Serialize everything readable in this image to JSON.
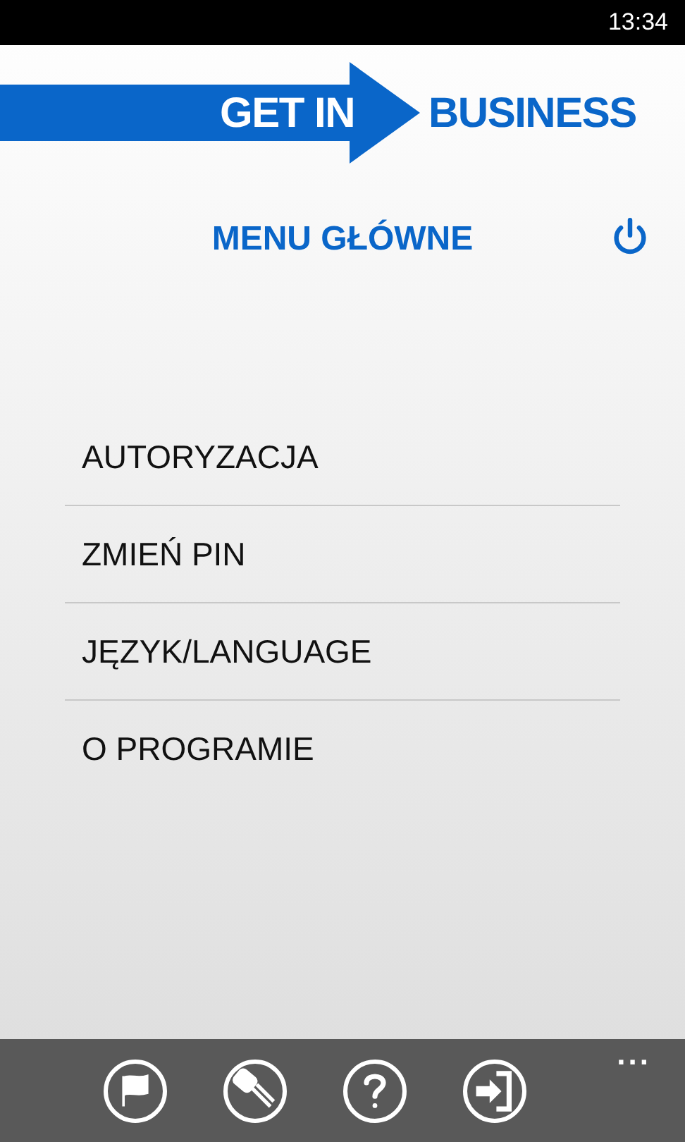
{
  "status_bar": {
    "time": "13:34"
  },
  "logo": {
    "left": "GET IN",
    "right": "BUSINESS"
  },
  "header": {
    "title": "MENU GŁÓWNE"
  },
  "menu": [
    "AUTORYZACJA",
    "ZMIEŃ PIN",
    "JĘZYK/LANGUAGE",
    "O PROGRAMIE"
  ],
  "app_bar": {
    "buttons": [
      {
        "kind": "flag"
      },
      {
        "kind": "key"
      },
      {
        "kind": "help"
      },
      {
        "kind": "exit"
      }
    ],
    "more": "..."
  }
}
